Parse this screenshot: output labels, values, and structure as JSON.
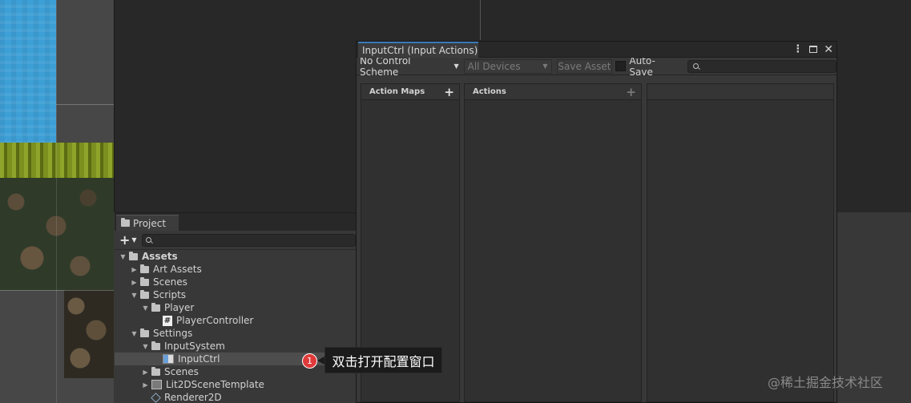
{
  "project_panel": {
    "tab_label": "Project",
    "add_button": "+",
    "tree": [
      {
        "label": "Assets",
        "level": 0,
        "expanded": true,
        "icon": "folder-icon",
        "bold": true
      },
      {
        "label": "Art Assets",
        "level": 1,
        "expanded": false,
        "icon": "folder-icon"
      },
      {
        "label": "Scenes",
        "level": 1,
        "expanded": false,
        "icon": "folder-icon"
      },
      {
        "label": "Scripts",
        "level": 1,
        "expanded": true,
        "icon": "folder-icon"
      },
      {
        "label": "Player",
        "level": 2,
        "expanded": true,
        "icon": "folder-icon"
      },
      {
        "label": "PlayerController",
        "level": 3,
        "icon": "csharp-script-icon"
      },
      {
        "label": "Settings",
        "level": 1,
        "expanded": true,
        "icon": "folder-icon"
      },
      {
        "label": "InputSystem",
        "level": 2,
        "expanded": true,
        "icon": "folder-icon"
      },
      {
        "label": "InputCtrl",
        "level": 3,
        "icon": "input-actions-icon",
        "selected": true
      },
      {
        "label": "Scenes",
        "level": 2,
        "expanded": false,
        "icon": "folder-icon"
      },
      {
        "label": "Lit2DSceneTemplate",
        "level": 2,
        "expanded": false,
        "icon": "scene-template-icon"
      },
      {
        "label": "Renderer2D",
        "level": 2,
        "icon": "renderer-icon"
      }
    ]
  },
  "input_actions_window": {
    "title": "InputCtrl (Input Actions)",
    "control_scheme": "No Control Scheme",
    "devices": "All Devices",
    "save_asset": "Save Asset",
    "auto_save": "Auto-Save",
    "auto_save_checked": false,
    "panes": {
      "action_maps": "Action Maps",
      "actions": "Actions"
    }
  },
  "callout": {
    "number": "1",
    "text": "双击打开配置窗口"
  },
  "watermark": "@稀土掘金技术社区",
  "colors": {
    "accent": "#3a79bb",
    "callout_badge": "#e03a3a"
  }
}
